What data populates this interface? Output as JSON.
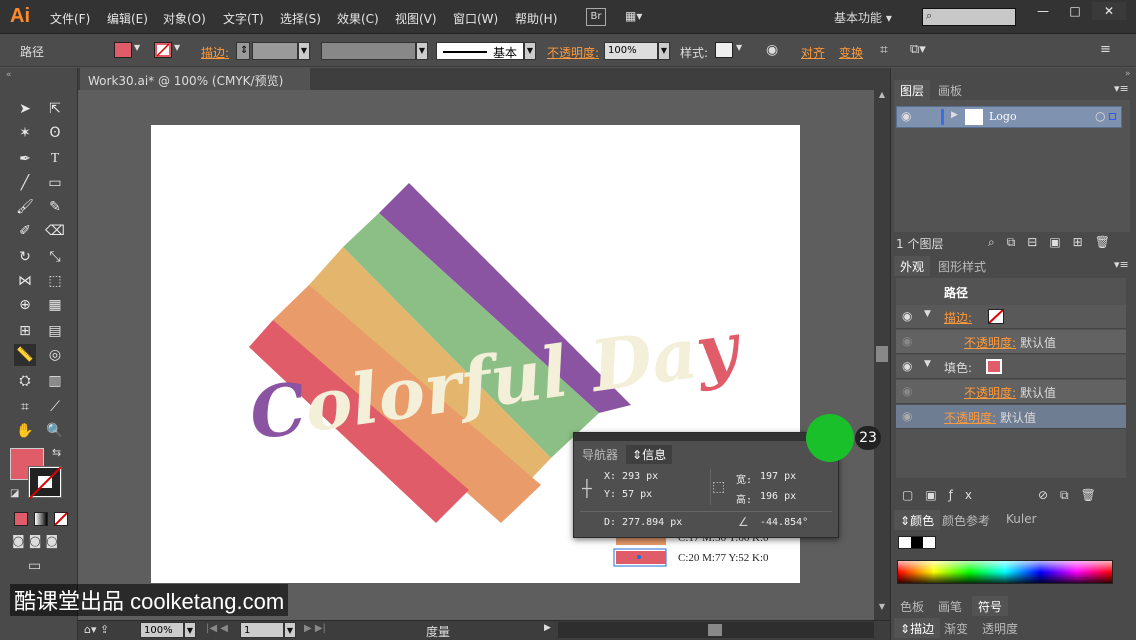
{
  "menubar": {
    "logo": "Ai",
    "items": [
      "文件(F)",
      "编辑(E)",
      "对象(O)",
      "文字(T)",
      "选择(S)",
      "效果(C)",
      "视图(V)",
      "窗口(W)",
      "帮助(H)"
    ],
    "br": "Br",
    "workspace": "基本功能",
    "win_min": "—",
    "win_max": "□",
    "win_close": "✕"
  },
  "control": {
    "object_type": "路径",
    "stroke_label": "描边:",
    "stroke_style": "基本",
    "opacity_label": "不透明度:",
    "opacity_value": "100%",
    "style_label": "样式:",
    "align_label": "对齐",
    "transform_label": "变换"
  },
  "document": {
    "tab_title": "Work30.ai* @ 100% (CMYK/预览)",
    "close": "×"
  },
  "artwork": {
    "text": "Colorful Day",
    "legend": [
      {
        "label": "C:17 M:56 Y:66 K:0",
        "color": "#e99b6a"
      },
      {
        "label": "C:20 M:77 Y:52 K:0",
        "color": "#e05c68"
      }
    ]
  },
  "info": {
    "tab_nav": "导航器",
    "tab_info": "信息",
    "x": "X: 293 px",
    "y": "Y: 57 px",
    "w_label": "宽:",
    "w": "197 px",
    "h_label": "高:",
    "h": "196 px",
    "d": "D:  277.894 px",
    "angle": "-44.854°"
  },
  "badge": "23",
  "layers": {
    "tab_layers": "图层",
    "tab_artboards": "画板",
    "layer_name": "Logo",
    "count": "1 个图层"
  },
  "appearance": {
    "tab_appearance": "外观",
    "tab_graphic_styles": "图形样式",
    "title": "路径",
    "stroke": "描边:",
    "opacity": "不透明度:",
    "default": "默认值",
    "fill": "填色:",
    "opacity2": "不透明度:",
    "default2": "默认值",
    "opacity3": "不透明度:",
    "default3": "默认值"
  },
  "color": {
    "tab_color": "颜色",
    "tab_guide": "颜色参考",
    "tab_kuler": "Kuler"
  },
  "swatches": {
    "tab1": "色板",
    "tab2": "画笔",
    "tab3": "符号"
  },
  "bottom_tabs": {
    "t1": "描边",
    "t2": "渐变",
    "t3": "透明度"
  },
  "status": {
    "zoom": "100%",
    "page": "1",
    "unit": "度量"
  },
  "watermark": "酷课堂出品 coolketang.com",
  "colors": {
    "purple": "#8b54a2",
    "green": "#8cbf86",
    "tan": "#e4b56c",
    "orange": "#e99b6a",
    "red": "#e05c68",
    "cream": "#f3efd8"
  }
}
